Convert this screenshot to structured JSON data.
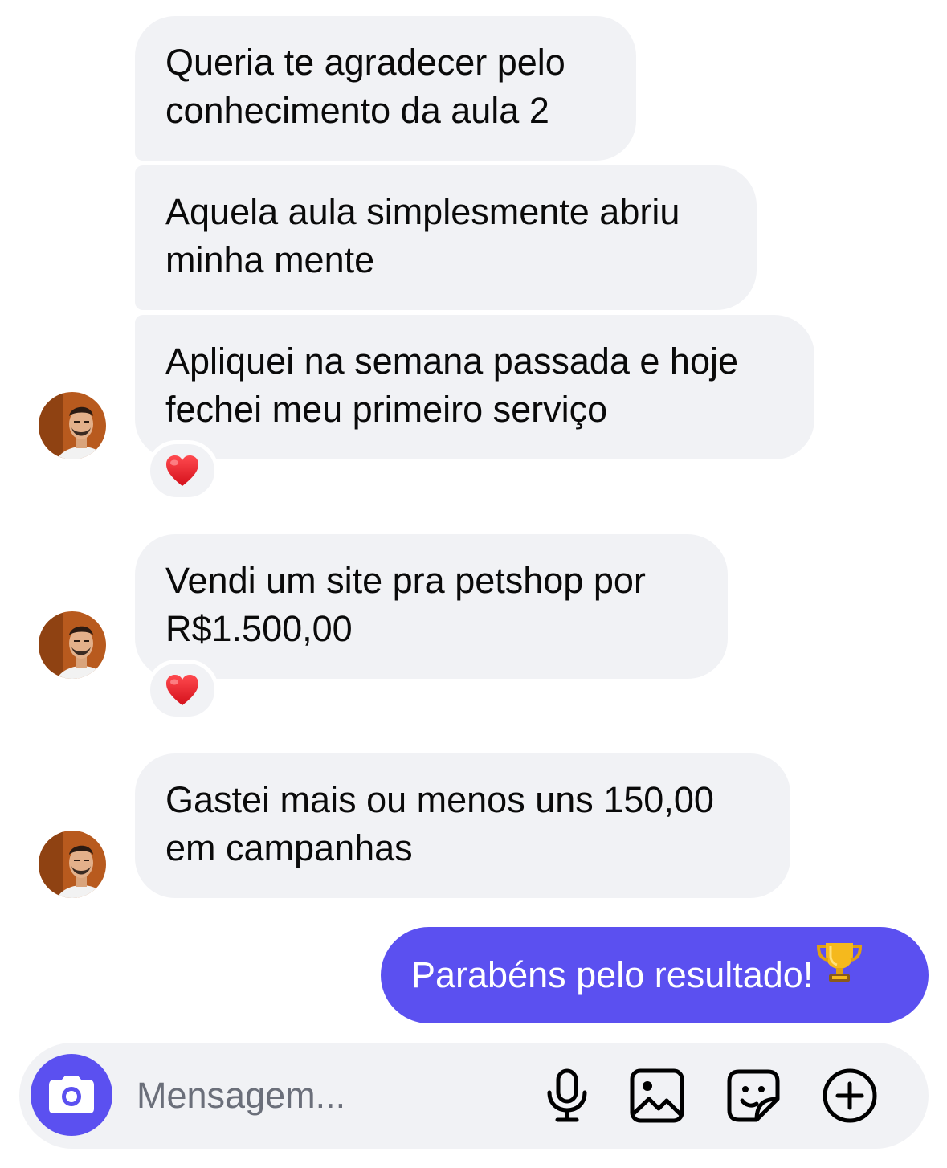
{
  "messages": [
    {
      "text": "Queria te agradecer pelo\nconhecimento da aula 2"
    },
    {
      "text": "Aquela aula simplesmente abriu\nminha mente"
    },
    {
      "text": "Apliquei na semana passada e hoje\nfechei meu primeiro serviço",
      "reaction": "❤️"
    },
    {
      "text": "Vendi um site pra petshop por\nR$1.500,00",
      "reaction": "❤️"
    },
    {
      "text": "Gastei mais ou menos uns 150,00\nem campanhas"
    }
  ],
  "sent_message": {
    "text": "Parabéns pelo resultado!",
    "emoji": "trophy"
  },
  "composer": {
    "placeholder": "Mensagem..."
  },
  "icons": [
    "camera-icon",
    "microphone-icon",
    "gallery-icon",
    "sticker-icon",
    "plus-circle-icon"
  ],
  "colors": {
    "accent": "#5b50f0",
    "received_bubble": "#f1f2f5",
    "heart": "#e8222b"
  }
}
